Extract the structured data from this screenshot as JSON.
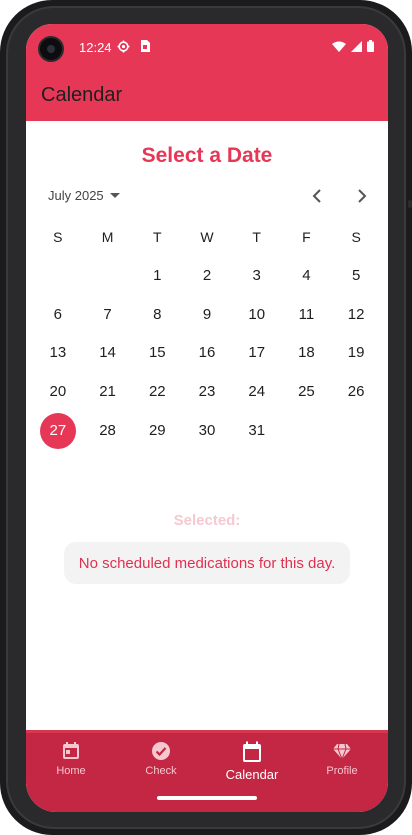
{
  "status_bar": {
    "time": "12:24"
  },
  "app_bar": {
    "title": "Calendar"
  },
  "heading": "Select a Date",
  "calendar": {
    "month_label": "July 2025",
    "weekdays": [
      "S",
      "M",
      "T",
      "W",
      "T",
      "F",
      "S"
    ],
    "leading_blanks": 2,
    "days": [
      "1",
      "2",
      "3",
      "4",
      "5",
      "6",
      "7",
      "8",
      "9",
      "10",
      "11",
      "12",
      "13",
      "14",
      "15",
      "16",
      "17",
      "18",
      "19",
      "20",
      "21",
      "22",
      "23",
      "24",
      "25",
      "26",
      "27",
      "28",
      "29",
      "30",
      "31"
    ],
    "selected_day": "27"
  },
  "selected_label": "Selected:",
  "empty_message": "No scheduled medications for this day.",
  "bottom_nav": {
    "items": [
      {
        "label": "Home",
        "icon": "calendar-day-icon"
      },
      {
        "label": "Check",
        "icon": "check-circle-icon"
      },
      {
        "label": "Calendar",
        "icon": "calendar-icon",
        "active": true
      },
      {
        "label": "Profile",
        "icon": "diamond-icon"
      }
    ]
  },
  "colors": {
    "accent": "#e63756",
    "nav_background": "#c32743",
    "selected_label": "#f6c9d1",
    "empty_text": "#e0314f"
  }
}
